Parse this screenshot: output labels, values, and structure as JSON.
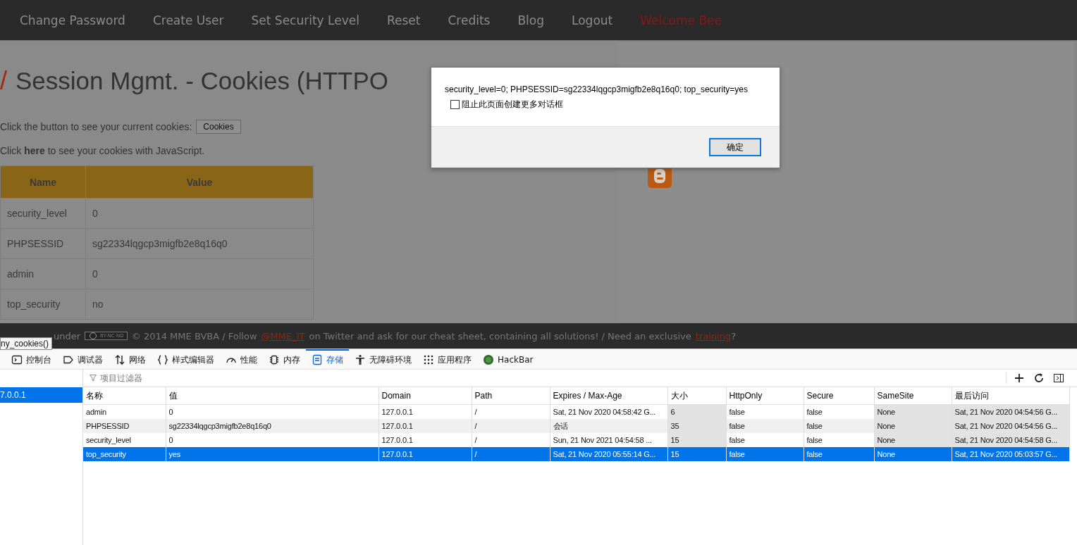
{
  "nav": {
    "items": [
      {
        "label": "Change Password",
        "kind": "link"
      },
      {
        "label": "Create User",
        "kind": "link"
      },
      {
        "label": "Set Security Level",
        "kind": "link"
      },
      {
        "label": "Reset",
        "kind": "link"
      },
      {
        "label": "Credits",
        "kind": "link"
      },
      {
        "label": "Blog",
        "kind": "link"
      },
      {
        "label": "Logout",
        "kind": "link"
      },
      {
        "label": "Welcome Bee",
        "kind": "greeting"
      }
    ]
  },
  "page": {
    "title_mark": "/",
    "title": "Session Mgmt. - Cookies (HTTPO",
    "intro": "Click the button to see your current cookies:",
    "cookies_button": "Cookies",
    "js_line": "Click **here** to see your cookies with JavaScript.",
    "table": {
      "columns": [
        "Name",
        "Value"
      ],
      "rows": [
        [
          "security_level",
          "0"
        ],
        [
          "PHPSESSID",
          "sg22334lqgcp3migfb2e8q16q0"
        ],
        [
          "admin",
          "0"
        ],
        [
          "top_security",
          "no"
        ]
      ]
    }
  },
  "footer": {
    "lead": "under",
    "license_badge": "BY-NC-ND",
    "text_1": "© 2014 MME BVBA / Follow",
    "link_1": "@MME_IT",
    "text_2": "on Twitter and ask for our cheat sheet, containing all solutions! / Need an exclusive",
    "link_2": "training",
    "text_3": "?"
  },
  "tooltip": "ny_cookies()",
  "dialog": {
    "message": "security_level=0; PHPSESSID=sg22334lqgcp3migfb2e8q16q0; top_security=yes",
    "checkbox": {
      "label": "阻止此页面创建更多对话框",
      "checked": false
    },
    "ok_button": "确定"
  },
  "devtools": {
    "tabs": [
      {
        "label": "控制台",
        "selected": false
      },
      {
        "label": "调试器",
        "selected": false
      },
      {
        "label": "网络",
        "selected": false
      },
      {
        "label": "样式编辑器",
        "selected": false
      },
      {
        "label": "性能",
        "selected": false
      },
      {
        "label": "内存",
        "selected": false
      },
      {
        "label": "存储",
        "selected": true
      },
      {
        "label": "无障碍环境",
        "selected": false
      },
      {
        "label": "应用程序",
        "selected": false
      },
      {
        "label": "HackBar",
        "selected": false
      }
    ],
    "sidebar": {
      "items": [
        {
          "label": "7.0.0.1",
          "selected": true
        }
      ]
    },
    "filter": {
      "placeholder": "项目过滤器"
    },
    "table": {
      "columns": [
        {
          "label": "名称",
          "shaded": false
        },
        {
          "label": "值",
          "shaded": false
        },
        {
          "label": "Domain",
          "shaded": false
        },
        {
          "label": "Path",
          "shaded": false
        },
        {
          "label": "Expires / Max-Age",
          "shaded": false
        },
        {
          "label": "大小",
          "shaded": true
        },
        {
          "label": "HttpOnly",
          "shaded": false
        },
        {
          "label": "Secure",
          "shaded": false
        },
        {
          "label": "SameSite",
          "shaded": true
        },
        {
          "label": "最后访问",
          "shaded": true
        }
      ],
      "rows": [
        {
          "selected": false,
          "cells": [
            "admin",
            "0",
            "127.0.0.1",
            "/",
            "Sat, 21 Nov 2020 04:58:42 G...",
            "6",
            "false",
            "false",
            "None",
            "Sat, 21 Nov 2020 04:54:56 G..."
          ]
        },
        {
          "selected": false,
          "cells": [
            "PHPSESSID",
            "sg22334lqgcp3migfb2e8q16q0",
            "127.0.0.1",
            "/",
            "会话",
            "35",
            "false",
            "false",
            "None",
            "Sat, 21 Nov 2020 04:54:56 G..."
          ]
        },
        {
          "selected": false,
          "cells": [
            "security_level",
            "0",
            "127.0.0.1",
            "/",
            "Sun, 21 Nov 2021 04:54:58 ...",
            "15",
            "false",
            "false",
            "None",
            "Sat, 21 Nov 2020 04:54:58 G..."
          ]
        },
        {
          "selected": true,
          "cells": [
            "top_security",
            "yes",
            "127.0.0.1",
            "/",
            "Sat, 21 Nov 2020 05:55:14 G...",
            "15",
            "false",
            "false",
            "None",
            "Sat, 21 Nov 2020 05:03:57 G..."
          ]
        }
      ]
    }
  }
}
